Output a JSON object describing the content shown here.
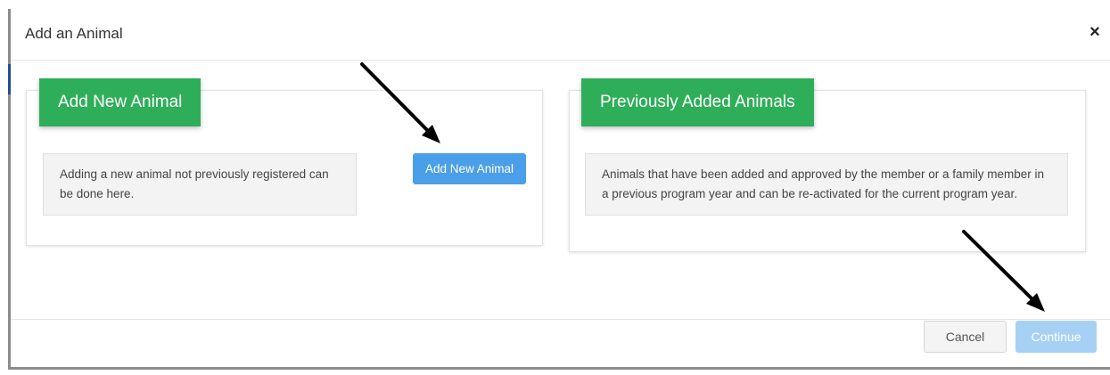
{
  "modal": {
    "title": "Add an Animal",
    "close_glyph": "×"
  },
  "add_new_section": {
    "tab_label": "Add New Animal",
    "description": "Adding a new animal not previously registered can be done here.",
    "button_label": "Add New Animal"
  },
  "previous_section": {
    "tab_label": "Previously Added Animals",
    "description": "Animals that have been added and approved by the member or a family member in a previous program year and can be re-activated for the current program year."
  },
  "footer": {
    "cancel_label": "Cancel",
    "continue_label": "Continue"
  },
  "colors": {
    "tab_green": "#2fae5a",
    "primary_button": "#4a9fe8",
    "continue_disabled": "#a6d1f5",
    "annotation_arrow": "#000000"
  },
  "icons": {
    "close": "close-icon",
    "annotation_arrows": "arrow-icon"
  }
}
